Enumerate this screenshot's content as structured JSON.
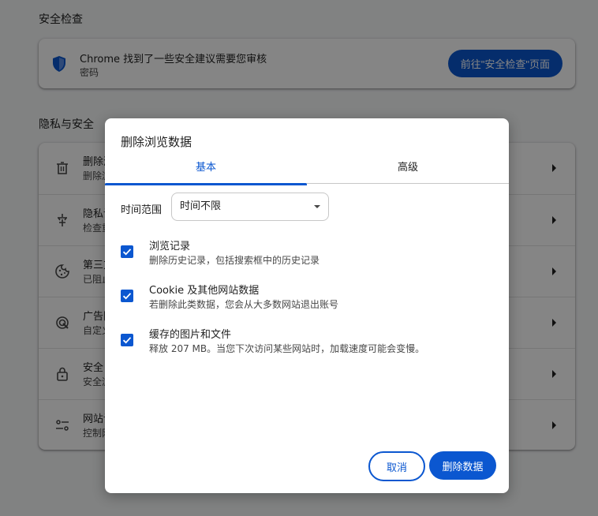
{
  "background": {
    "safety_section_title": "安全检查",
    "safety_card": {
      "line1": "Chrome 找到了一些安全建议需要您审核",
      "line2": "密码",
      "button_label": "前往\"安全检查\"页面"
    },
    "privacy_section_title": "隐私与安全",
    "privacy_rows": [
      {
        "icon": "trash-icon",
        "title": "删除浏",
        "subtitle": "删除浏"
      },
      {
        "icon": "privacy-guide-icon",
        "title": "隐私设",
        "subtitle": "检查重"
      },
      {
        "icon": "cookie-icon",
        "title": "第三方",
        "subtitle": "已阻止"
      },
      {
        "icon": "ad-privacy-icon",
        "title": "广告隐",
        "subtitle": "自定义"
      },
      {
        "icon": "lock-icon",
        "title": "安全",
        "subtitle": "安全浏"
      },
      {
        "icon": "sliders-icon",
        "title": "网站设",
        "subtitle": "控制网"
      }
    ]
  },
  "dialog": {
    "title": "删除浏览数据",
    "tabs": [
      {
        "label": "基本",
        "active": true
      },
      {
        "label": "高级",
        "active": false
      }
    ],
    "time_range_label": "时间范围",
    "time_range_value": "时间不限",
    "options": [
      {
        "title": "浏览记录",
        "subtitle": "删除历史记录，包括搜索框中的历史记录",
        "checked": true
      },
      {
        "title": "Cookie 及其他网站数据",
        "subtitle": "若删除此类数据，您会从大多数网站退出账号",
        "checked": true
      },
      {
        "title": "缓存的图片和文件",
        "subtitle": "释放 207 MB。当您下次访问某些网站时，加载速度可能会变慢。",
        "checked": true
      }
    ],
    "cancel_label": "取消",
    "delete_label": "删除数据"
  },
  "colors": {
    "accent": "#0b57d0",
    "scrim": "rgba(0,0,0,0.48)"
  }
}
